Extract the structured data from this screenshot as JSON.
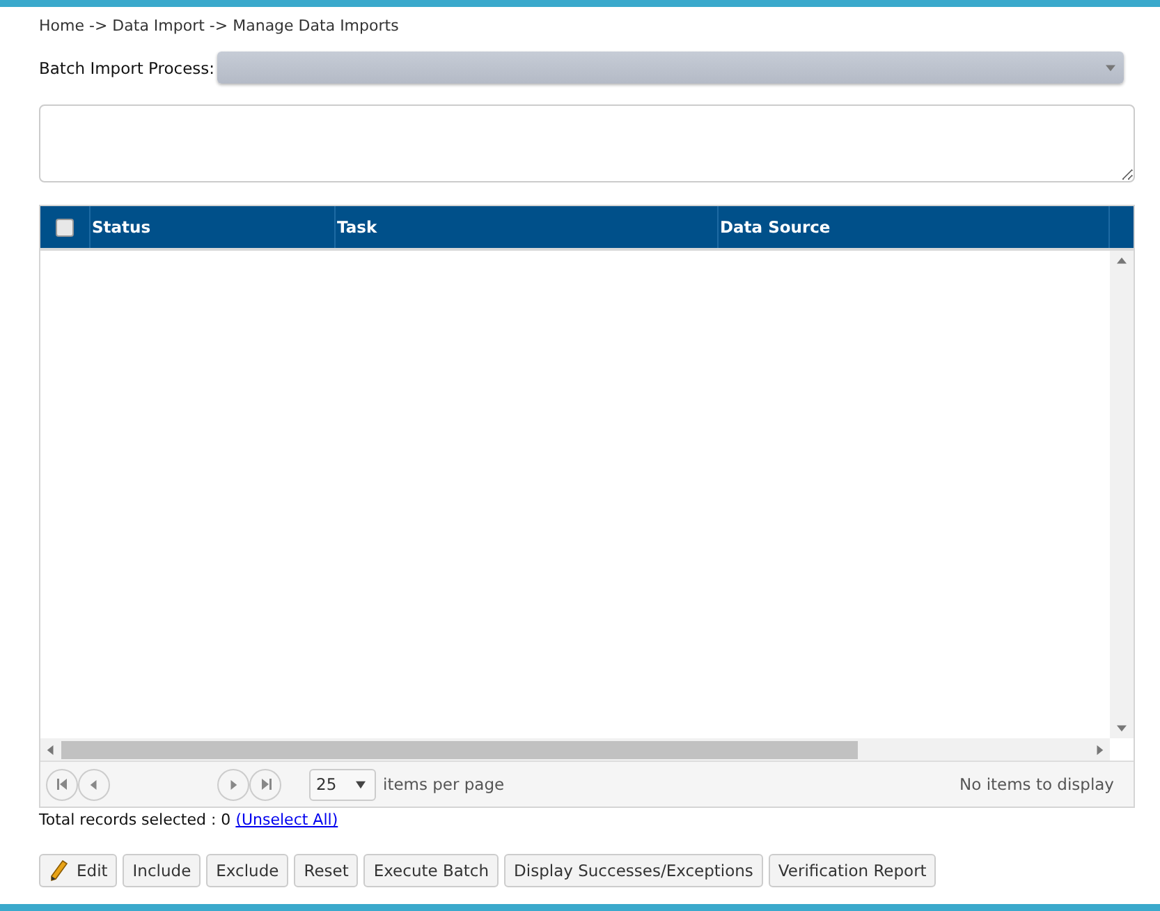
{
  "breadcrumb": "Home -> Data Import -> Manage Data Imports",
  "batch_import": {
    "label": "Batch Import Process:"
  },
  "grid": {
    "select_all_checked": false,
    "columns": [
      "Status",
      "Task",
      "Data Source"
    ],
    "page_size": "25",
    "page_size_label": "items per page",
    "empty_message": "No items to display"
  },
  "selection": {
    "text": "Total records selected : 0",
    "link": "(Unselect All)"
  },
  "buttons": [
    {
      "label": "Edit",
      "kind": "edit"
    },
    {
      "label": "Include",
      "kind": "plain"
    },
    {
      "label": "Exclude",
      "kind": "plain"
    },
    {
      "label": "Reset",
      "kind": "plain"
    },
    {
      "label": "Execute Batch",
      "kind": "plain"
    },
    {
      "label": "Display Successes/Exceptions",
      "kind": "plain"
    },
    {
      "label": "Verification Report",
      "kind": "plain"
    }
  ]
}
